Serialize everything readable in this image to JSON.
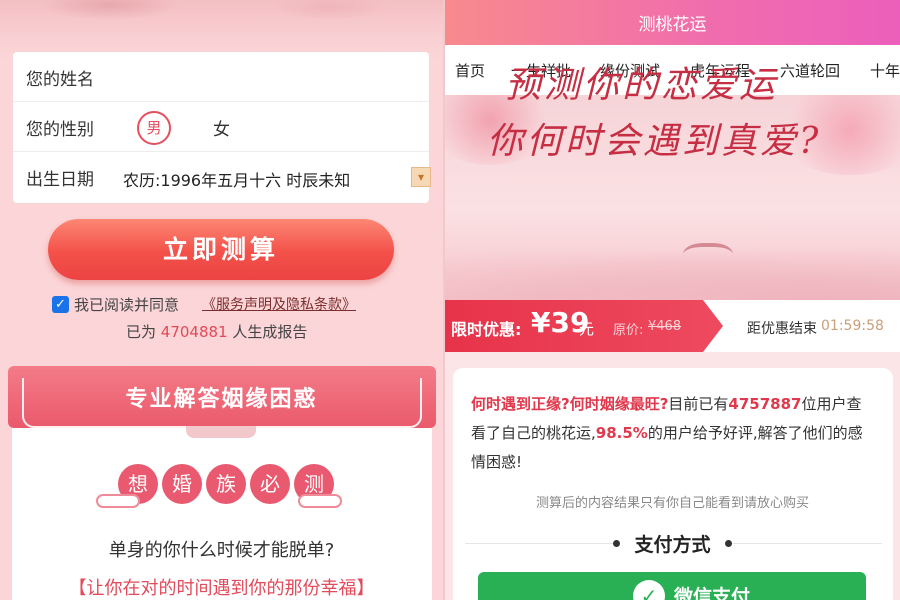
{
  "left": {
    "form": {
      "name_placeholder": "您的姓名",
      "gender_label": "您的性别",
      "gender_male": "男",
      "gender_female": "女",
      "birth_label": "出生日期",
      "birth_value": "农历:1996年五月十六 时辰未知",
      "dropdown_icon": "chevron-down-icon"
    },
    "calc_button": "立即测算",
    "agree": {
      "checked": true,
      "text": "我已阅读并同意",
      "link": "《服务声明及隐私条款》"
    },
    "reports": {
      "prefix": "已为",
      "count": "4704881",
      "suffix": "人生成报告"
    },
    "card": {
      "title": "专业解答姻缘困惑",
      "circles": [
        "想",
        "婚",
        "族",
        "必",
        "测"
      ],
      "question": "单身的你什么时候才能脱单?",
      "answer": "【让你在对的时间遇到你的那份幸福】"
    }
  },
  "right": {
    "title": "测桃花运",
    "nav": [
      "首页",
      "一生祥批",
      "缘份测试",
      "虎年运程",
      "六道轮回",
      "十年"
    ],
    "banner": {
      "line1": "预测你的恋爱运",
      "line2": "你何时会遇到真爱?"
    },
    "price": {
      "label": "限时优惠:",
      "currency": "¥",
      "amount": "39",
      "unit": "元",
      "orig_label": "原价:",
      "orig_price": "¥468",
      "countdown_label": "距优惠结束",
      "countdown": "01:59:58"
    },
    "info": {
      "q": "何时遇到正缘?何时姻缘最旺?",
      "t1": "目前已有",
      "n1": "4757887",
      "t2": "位用户查看了自己的桃花运,",
      "n2": "98.5%",
      "t3": "的用户给予好评,解答了他们的感情困惑!",
      "note": "测算后的内容结果只有你自己能看到请放心购买"
    },
    "payment": {
      "title": "支付方式",
      "wechat": "微信支付",
      "wechat_icon": "wechat-check-icon"
    }
  },
  "colors": {
    "accent": "#e7334a",
    "wechat": "#2ab054",
    "topbar": "#f06cae"
  }
}
